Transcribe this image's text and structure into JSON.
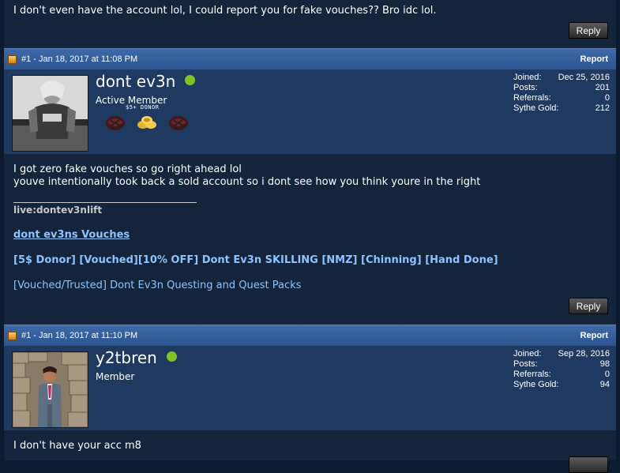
{
  "top_post": {
    "text": "I don't even have the account lol, I could report you for fake vouches?? Bro idc lol.",
    "reply_label": "Reply"
  },
  "post1": {
    "header": {
      "num_date": "#1 - Jan 18, 2017 at 11:08 PM",
      "report": "Report"
    },
    "user": {
      "name": "dont ev3n",
      "rank": "Active Member",
      "donor_label": "$5+ DONOR",
      "badges": [
        "dragon-badge-icon",
        "gold-coins-icon",
        "dragon-badge-icon"
      ],
      "stats": [
        {
          "label": "Joined:",
          "value": "Dec 25, 2016"
        },
        {
          "label": "Posts:",
          "value": "201"
        },
        {
          "label": "Referrals:",
          "value": "0"
        },
        {
          "label": "Sythe Gold:",
          "value": "212"
        }
      ]
    },
    "body": {
      "line1": "I got zero fake vouches so go right ahead lol",
      "line2": "youve intentionally took back a sold account so i dont see how you think youre in the right",
      "sig_live": "live:dontev3nlift",
      "sig_vouches": "dont ev3ns Vouches",
      "sig_thread1": "[5$ Donor] [Vouched][10% OFF] Dont Ev3n SKILLING [NMZ] [Chinning] [Hand Done]",
      "sig_thread2": "[Vouched/Trusted] Dont Ev3n Questing and Quest Packs"
    },
    "reply_label": "Reply"
  },
  "post2": {
    "header": {
      "num_date": "#1 - Jan 18, 2017 at 11:10 PM",
      "report": "Report"
    },
    "user": {
      "name": "y2tbren",
      "rank": "Member",
      "stats": [
        {
          "label": "Joined:",
          "value": "Sep 28, 2016"
        },
        {
          "label": "Posts:",
          "value": "98"
        },
        {
          "label": "Referrals:",
          "value": "0"
        },
        {
          "label": "Sythe Gold:",
          "value": "94"
        }
      ]
    },
    "body": {
      "line1": "I don't have your acc m8"
    }
  },
  "colors": {
    "header_blue": "#2c5591",
    "userbar": "#1e3a60",
    "post_bg": "#13243b",
    "link": "#8ec3ff",
    "online": "#7fc41f"
  }
}
